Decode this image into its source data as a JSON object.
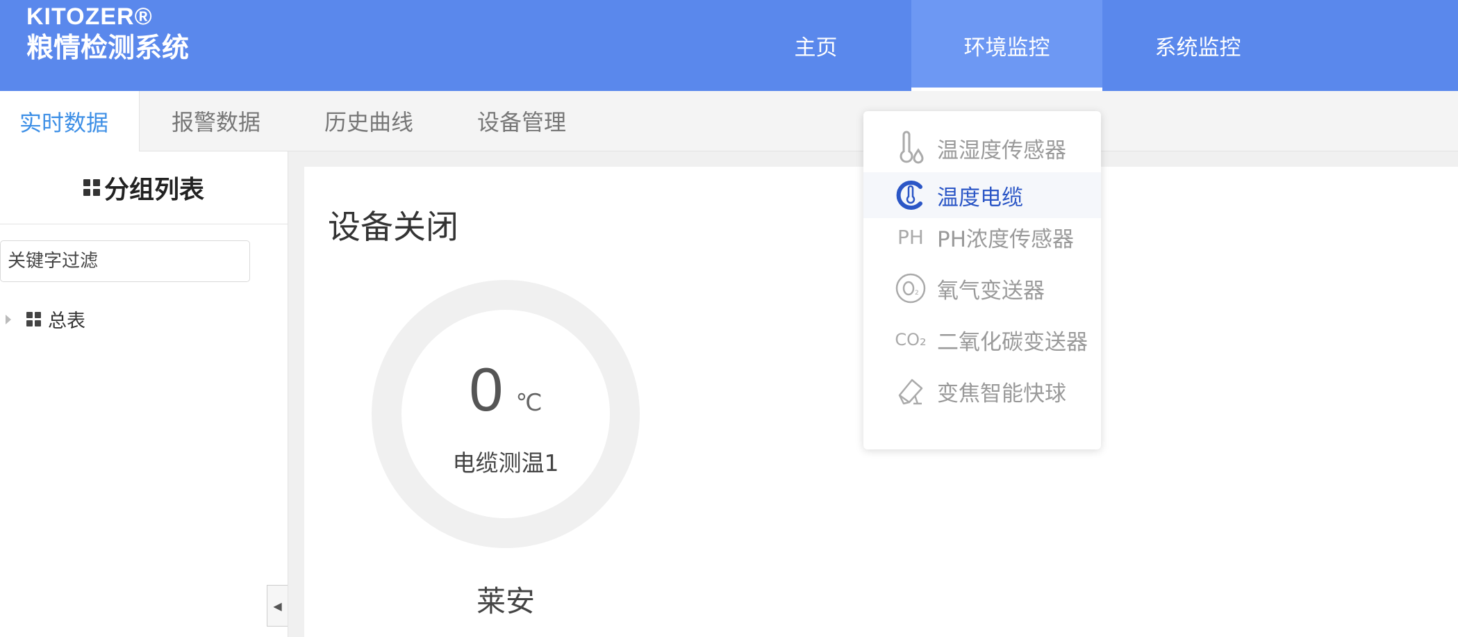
{
  "brand": {
    "name": "KITOZER®",
    "title": "粮情检测系统"
  },
  "topnav": [
    {
      "label": "主页"
    },
    {
      "label": "环境监控",
      "active": true
    },
    {
      "label": "系统监控"
    }
  ],
  "subtabs": [
    {
      "label": "实时数据",
      "active": true
    },
    {
      "label": "报警数据"
    },
    {
      "label": "历史曲线"
    },
    {
      "label": "设备管理"
    }
  ],
  "sidebar": {
    "title": "分组列表",
    "filter_placeholder": "关键字过滤",
    "tree": [
      {
        "label": "总表"
      }
    ],
    "collapse_icon": "◀"
  },
  "panel": {
    "status": "设备关闭",
    "gauge": {
      "value": "0",
      "unit": "℃",
      "name": "电缆测温1",
      "location": "莱安"
    }
  },
  "dropdown": {
    "items": [
      {
        "label": "温湿度传感器",
        "icon": "thermometer-drop-icon"
      },
      {
        "label": "温度电缆",
        "icon": "temperature-cable-icon",
        "active": true
      },
      {
        "label": "PH浓度传感器",
        "icon": "ph-icon",
        "icon_text": "PH"
      },
      {
        "label": "氧气变送器",
        "icon": "o2-icon"
      },
      {
        "label": "二氧化碳变送器",
        "icon": "co2-icon",
        "icon_text": "CO₂"
      },
      {
        "label": "变焦智能快球",
        "icon": "camera-icon"
      }
    ]
  },
  "colors": {
    "header": "#5a88ec",
    "accent": "#3d8fe6",
    "active_menu": "#2b56c6"
  }
}
